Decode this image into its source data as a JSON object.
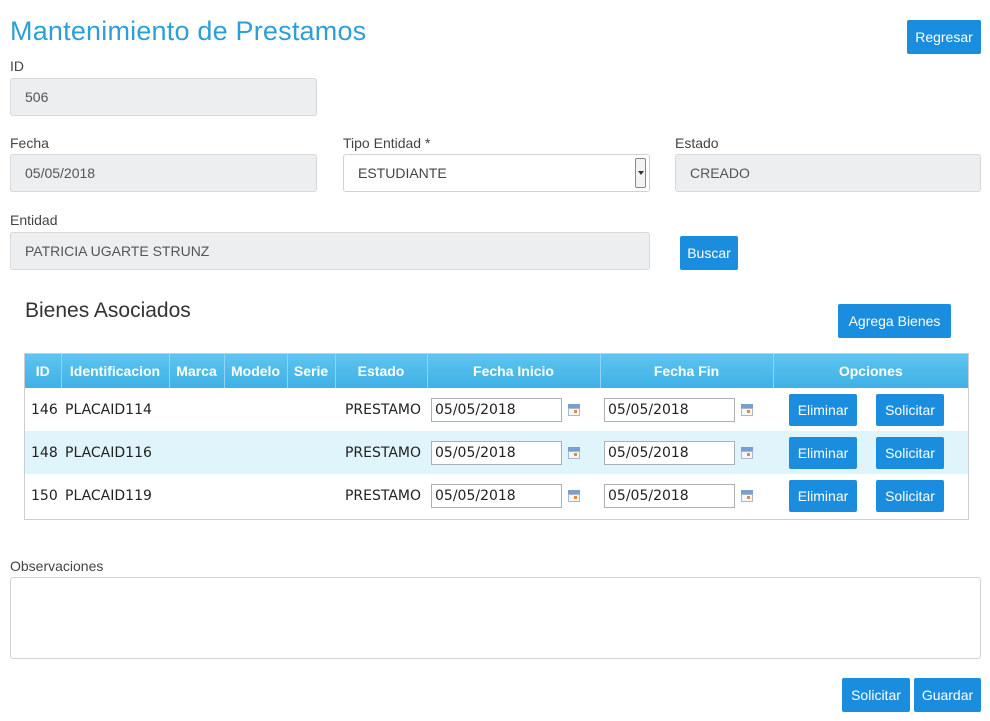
{
  "header": {
    "title": "Mantenimiento de Prestamos",
    "back_label": "Regresar"
  },
  "form": {
    "id_label": "ID",
    "id_value": "506",
    "fecha_label": "Fecha",
    "fecha_value": "05/05/2018",
    "tipo_entidad_label": "Tipo Entidad *",
    "tipo_entidad_value": "ESTUDIANTE",
    "estado_label": "Estado",
    "estado_value": "CREADO",
    "entidad_label": "Entidad",
    "entidad_value": "PATRICIA  UGARTE STRUNZ",
    "buscar_label": "Buscar"
  },
  "bienes": {
    "title": "Bienes Asociados",
    "add_label": "Agrega Bienes",
    "columns": [
      "ID",
      "Identificacion",
      "Marca",
      "Modelo",
      "Serie",
      "Estado",
      "Fecha Inicio",
      "Fecha Fin",
      "Opciones"
    ],
    "rows": [
      {
        "id": "146",
        "identificacion": "PLACAID114",
        "marca": "",
        "modelo": "",
        "serie": "",
        "estado": "PRESTAMO",
        "fecha_inicio": "05/05/2018",
        "fecha_fin": "05/05/2018"
      },
      {
        "id": "148",
        "identificacion": "PLACAID116",
        "marca": "",
        "modelo": "",
        "serie": "",
        "estado": "PRESTAMO",
        "fecha_inicio": "05/05/2018",
        "fecha_fin": "05/05/2018"
      },
      {
        "id": "150",
        "identificacion": "PLACAID119",
        "marca": "",
        "modelo": "",
        "serie": "",
        "estado": "PRESTAMO",
        "fecha_inicio": "05/05/2018",
        "fecha_fin": "05/05/2018"
      }
    ],
    "eliminar_label": "Eliminar",
    "solicitar_label": "Solicitar"
  },
  "observaciones": {
    "label": "Observaciones",
    "value": ""
  },
  "footer": {
    "solicitar_label": "Solicitar",
    "guardar_label": "Guardar"
  },
  "colors": {
    "accent": "#1a8dde",
    "title": "#2c9fd9",
    "table_header": "#3fb1e6",
    "alt_row": "#e0f5fb"
  },
  "icons": {
    "date_picker": "calendar-icon",
    "dropdown": "chevron-down-icon"
  }
}
